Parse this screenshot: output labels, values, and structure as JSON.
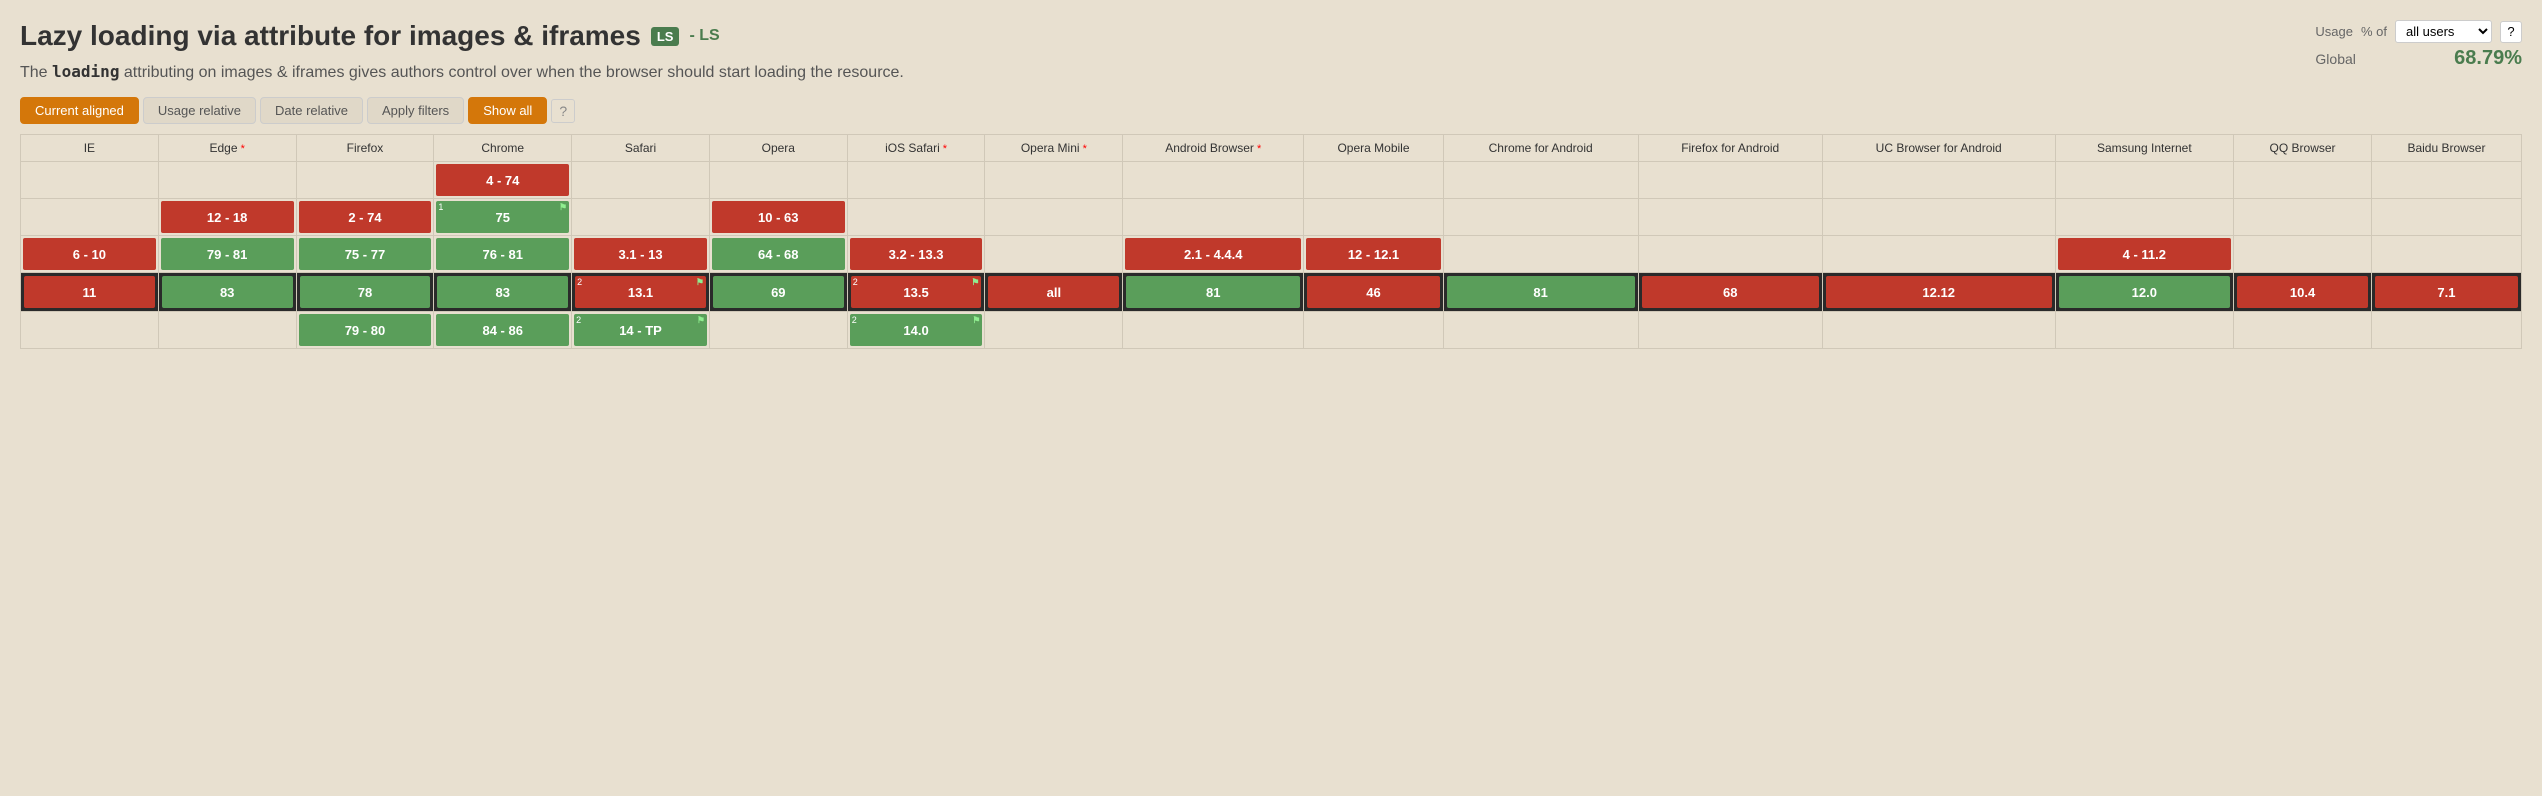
{
  "title": "Lazy loading via attribute for images & iframes",
  "ls_badge": "LS",
  "ls_dash": "- LS",
  "description_part1": "The ",
  "description_code": "loading",
  "description_part2": " attributing on images & iframes gives authors control over when the browser should start loading the resource.",
  "usage_panel": {
    "label": "Usage",
    "percent_label": "% of",
    "select_value": "all users",
    "help_symbol": "?",
    "global_label": "Global",
    "global_percent": "68.79%"
  },
  "filters": {
    "current_aligned": "Current aligned",
    "usage_relative": "Usage relative",
    "date_relative": "Date relative",
    "apply_filters": "Apply filters",
    "show_all": "Show all",
    "help": "?"
  },
  "browsers": [
    {
      "id": "ie",
      "name": "IE",
      "divider_class": "ie-divider"
    },
    {
      "id": "edge",
      "name": "Edge",
      "divider_class": "edge-divider",
      "asterisk": true
    },
    {
      "id": "firefox",
      "name": "Firefox",
      "divider_class": "firefox-divider"
    },
    {
      "id": "chrome",
      "name": "Chrome",
      "divider_class": "chrome-divider"
    },
    {
      "id": "safari",
      "name": "Safari",
      "divider_class": "safari-divider"
    },
    {
      "id": "opera",
      "name": "Opera",
      "divider_class": "opera-divider"
    },
    {
      "id": "ios-safari",
      "name": "iOS Safari",
      "divider_class": "ios-safari-divider",
      "asterisk": true
    },
    {
      "id": "opera-mini",
      "name": "Opera Mini",
      "divider_class": "opera-mini-divider",
      "asterisk": true
    },
    {
      "id": "android-browser",
      "name": "Android Browser",
      "divider_class": "android-browser-divider",
      "asterisk": true
    },
    {
      "id": "opera-mobile",
      "name": "Opera Mobile",
      "divider_class": "opera-mobile-divider"
    },
    {
      "id": "chrome-android",
      "name": "Chrome for Android",
      "divider_class": "chrome-android-divider"
    },
    {
      "id": "firefox-android",
      "name": "Firefox for Android",
      "divider_class": "firefox-android-divider"
    },
    {
      "id": "uc-browser",
      "name": "UC Browser for Android",
      "divider_class": "uc-browser-divider"
    },
    {
      "id": "samsung",
      "name": "Samsung Internet",
      "divider_class": "samsung-divider"
    },
    {
      "id": "qq",
      "name": "QQ Browser",
      "divider_class": "qq-divider"
    },
    {
      "id": "baidu",
      "name": "Baidu Browser",
      "divider_class": "baidu-divider"
    }
  ]
}
